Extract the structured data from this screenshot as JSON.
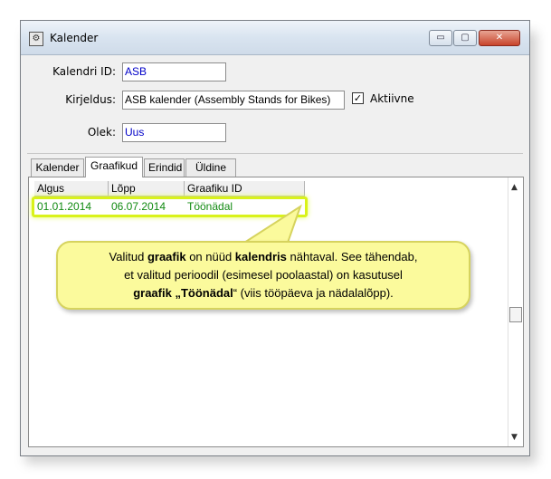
{
  "window": {
    "title": "Kalender",
    "buttons": {
      "minimize": "▭",
      "maximize": "▢",
      "close": "✕"
    }
  },
  "form": {
    "calendar_id_label": "Kalendri ID:",
    "calendar_id_value": "ASB",
    "description_label": "Kirjeldus:",
    "description_value": "ASB kalender (Assembly Stands for Bikes)",
    "active_label": "Aktiivne",
    "active_checked": true,
    "status_label": "Olek:",
    "status_value": "Uus"
  },
  "tabs": [
    {
      "label": "Kalender",
      "active": false
    },
    {
      "label": "Graafikud",
      "active": true
    },
    {
      "label": "Erindid",
      "active": false
    },
    {
      "label": "Üldine",
      "active": false
    }
  ],
  "table": {
    "columns": [
      "Algus",
      "Lõpp",
      "Graafiku ID"
    ],
    "rows": [
      [
        "01.01.2014",
        "06.07.2014",
        "Töönädal"
      ]
    ]
  },
  "callout": {
    "part1": "Valitud ",
    "part2": "graafik",
    "part3": " on nüüd ",
    "part4": "kalendris",
    "part5": " nähtaval. See tähendab,",
    "line2": "et  valitud perioodil (esimesel poolaastal) on kasutusel",
    "part6": "graafik „Töönädal",
    "part7": "“  (viis tööpäeva ja nädalalõpp)."
  },
  "colors": {
    "row_text": "#118a11",
    "highlight": "#d9f21a",
    "callout_bg": "#fbfa9c",
    "input_text_blue": "#0000c8"
  }
}
